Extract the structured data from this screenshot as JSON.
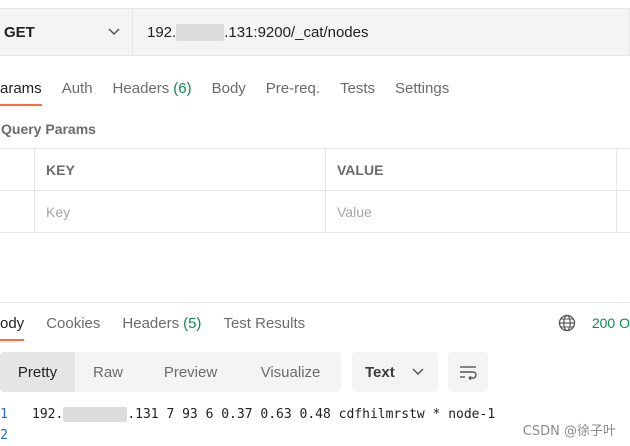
{
  "request": {
    "method": "GET",
    "url_prefix": "192.",
    "url_suffix": ".131:9200/_cat/nodes"
  },
  "request_tabs": [
    {
      "label": "arams",
      "count": ""
    },
    {
      "label": "Auth",
      "count": ""
    },
    {
      "label": "Headers",
      "count": "(6)"
    },
    {
      "label": "Body",
      "count": ""
    },
    {
      "label": "Pre-req.",
      "count": ""
    },
    {
      "label": "Tests",
      "count": ""
    },
    {
      "label": "Settings",
      "count": ""
    }
  ],
  "query_params": {
    "title": "Query Params",
    "headers": {
      "key": "KEY",
      "value": "VALUE"
    },
    "placeholders": {
      "key": "Key",
      "value": "Value"
    }
  },
  "response_tabs": [
    {
      "label": "ody",
      "count": ""
    },
    {
      "label": "Cookies",
      "count": ""
    },
    {
      "label": "Headers",
      "count": "(5)"
    },
    {
      "label": "Test Results",
      "count": ""
    }
  ],
  "response_status": "200 O",
  "view_modes": [
    "Pretty",
    "Raw",
    "Preview",
    "Visualize"
  ],
  "format": "Text",
  "response_lines": [
    {
      "num": "1",
      "prefix": "192.",
      "suffix": ".131 7 93 6 0.37 0.63 0.48 cdfhilmrstw * node-1"
    },
    {
      "num": "2",
      "prefix": "",
      "suffix": ""
    }
  ],
  "watermark": "CSDN @徐子叶",
  "colors": {
    "accent": "#ff6c37",
    "status_ok": "#0f8a4f",
    "line_number": "#1a73c7"
  }
}
